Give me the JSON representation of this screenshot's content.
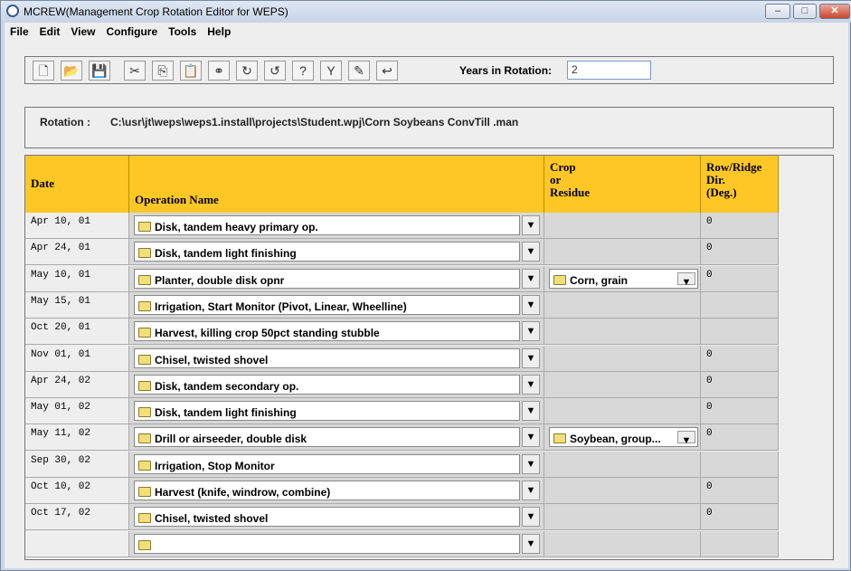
{
  "window": {
    "title": "MCREW(Management Crop Rotation Editor for WEPS)",
    "minimize": "–",
    "maximize": "□",
    "close": "✕"
  },
  "menu": [
    "File",
    "Edit",
    "View",
    "Configure",
    "Tools",
    "Help"
  ],
  "toolbar": {
    "icons": [
      "new-file-icon",
      "open-folder-icon",
      "save-icon",
      "cut-icon",
      "copy-icon",
      "paste-icon",
      "link-icon",
      "rotate-right-icon",
      "rotate-left-icon",
      "help-icon",
      "filter-icon",
      "edit-pencil-icon",
      "undo-arrow-icon"
    ],
    "years_label": "Years in Rotation:",
    "years_value": "2"
  },
  "rotation": {
    "label": "Rotation :",
    "path": "C:\\usr\\jt\\weps\\weps1.install\\projects\\Student.wpj\\Corn Soybeans ConvTill .man"
  },
  "table": {
    "headers": {
      "date": "Date",
      "operation": "Operation Name",
      "crop": [
        "Crop",
        "or",
        "Residue"
      ],
      "dir": [
        "Row/Ridge",
        "Dir.",
        "(Deg.)"
      ]
    },
    "rows": [
      {
        "date": "Apr 10, 01",
        "op": "Disk, tandem heavy primary op.",
        "crop": "",
        "dir": "0"
      },
      {
        "date": "Apr 24, 01",
        "op": "Disk, tandem light finishing",
        "crop": "",
        "dir": "0"
      },
      {
        "date": "May 10, 01",
        "op": "Planter, double disk opnr",
        "crop": "Corn, grain",
        "dir": "0"
      },
      {
        "date": "May 15, 01",
        "op": "Irrigation, Start Monitor (Pivot, Linear, Wheelline)",
        "crop": "",
        "dir": ""
      },
      {
        "date": "Oct 20, 01",
        "op": "Harvest, killing crop 50pct standing stubble",
        "crop": "",
        "dir": ""
      },
      {
        "date": "Nov 01, 01",
        "op": "Chisel, twisted shovel",
        "crop": "",
        "dir": "0"
      },
      {
        "date": "Apr 24, 02",
        "op": "Disk, tandem secondary op.",
        "crop": "",
        "dir": "0"
      },
      {
        "date": "May 01, 02",
        "op": "Disk, tandem light finishing",
        "crop": "",
        "dir": "0"
      },
      {
        "date": "May 11, 02",
        "op": "Drill or airseeder, double disk",
        "crop": "Soybean, group...",
        "dir": "0"
      },
      {
        "date": "Sep 30, 02",
        "op": "Irrigation, Stop Monitor",
        "crop": "",
        "dir": ""
      },
      {
        "date": "Oct 10, 02",
        "op": "Harvest (knife, windrow, combine)",
        "crop": "",
        "dir": "0"
      },
      {
        "date": "Oct 17, 02",
        "op": "Chisel, twisted shovel",
        "crop": "",
        "dir": "0"
      },
      {
        "date": "",
        "op": "",
        "crop": "",
        "dir": ""
      }
    ]
  }
}
